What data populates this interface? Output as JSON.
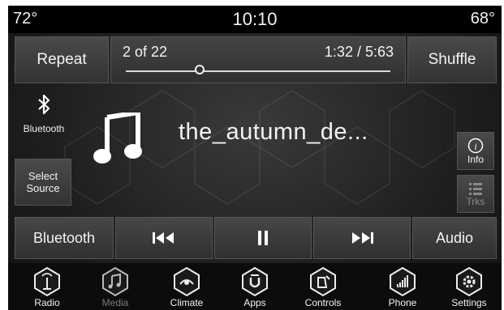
{
  "status": {
    "temp_left": "72°",
    "clock": "10:10",
    "temp_right": "68°"
  },
  "controls": {
    "repeat_label": "Repeat",
    "shuffle_label": "Shuffle"
  },
  "progress": {
    "track_count": "2 of 22",
    "time": "1:32 / 5:63",
    "fraction": 0.28
  },
  "source": {
    "bluetooth_label": "Bluetooth",
    "select_source_label": "Select\nSource"
  },
  "now_playing": {
    "title": "the_autumn_de..."
  },
  "side": {
    "info_label": "Info",
    "trks_label": "Trks"
  },
  "transport": {
    "bluetooth_label": "Bluetooth",
    "audio_label": "Audio"
  },
  "nav": [
    {
      "label": "Radio",
      "icon": "radio-icon",
      "active": true
    },
    {
      "label": "Media",
      "icon": "media-icon",
      "active": false
    },
    {
      "label": "Climate",
      "icon": "climate-icon",
      "active": true
    },
    {
      "label": "Apps",
      "icon": "apps-icon",
      "active": true
    },
    {
      "label": "Controls",
      "icon": "controls-icon",
      "active": true
    },
    {
      "label": "Phone",
      "icon": "phone-icon",
      "active": true
    },
    {
      "label": "Settings",
      "icon": "settings-icon",
      "active": true
    }
  ],
  "colors": {
    "background": "#1e1e1e",
    "statusbar": "#000000",
    "text": "#f2f2f2",
    "dim": "#7a7a7a"
  }
}
